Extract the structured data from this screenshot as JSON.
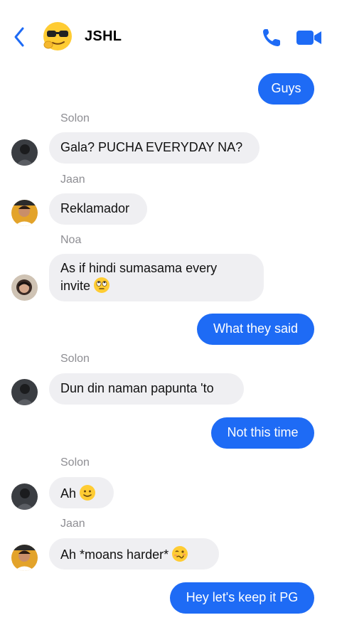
{
  "header": {
    "title": "JSHL",
    "avatar_icon": "sunglasses-thinking-emoji",
    "back_icon": "chevron-left-icon",
    "call_icon": "phone-icon",
    "video_icon": "video-camera-icon",
    "accent": "#1e6bf5"
  },
  "messages": [
    {
      "dir": "out",
      "text": "Guys"
    },
    {
      "dir": "in",
      "sender": "Solon",
      "text": "Gala? PUCHA EVERYDAY NA?"
    },
    {
      "dir": "in",
      "sender": "Jaan",
      "text": "Reklamador"
    },
    {
      "dir": "in",
      "sender": "Noa",
      "line1": "As if hindi sumasama every",
      "line2": "invite",
      "emoji": "eye-roll-emoji"
    },
    {
      "dir": "out",
      "text": "What they said"
    },
    {
      "dir": "in",
      "sender": "Solon",
      "text": "Dun din naman papunta 'to"
    },
    {
      "dir": "out",
      "text": "Not this time"
    },
    {
      "dir": "in",
      "sender": "Solon",
      "text": "Ah",
      "emoji": "slight-smile-emoji"
    },
    {
      "dir": "in",
      "sender": "Jaan",
      "text": "Ah *moans harder*",
      "emoji": "woozy-face-emoji"
    },
    {
      "dir": "out",
      "text": "Hey let's keep it PG"
    }
  ],
  "colors": {
    "incoming_bubble": "#efeff2",
    "outgoing_bubble": "#1e6bf5",
    "sender_name": "#8e8e93"
  }
}
